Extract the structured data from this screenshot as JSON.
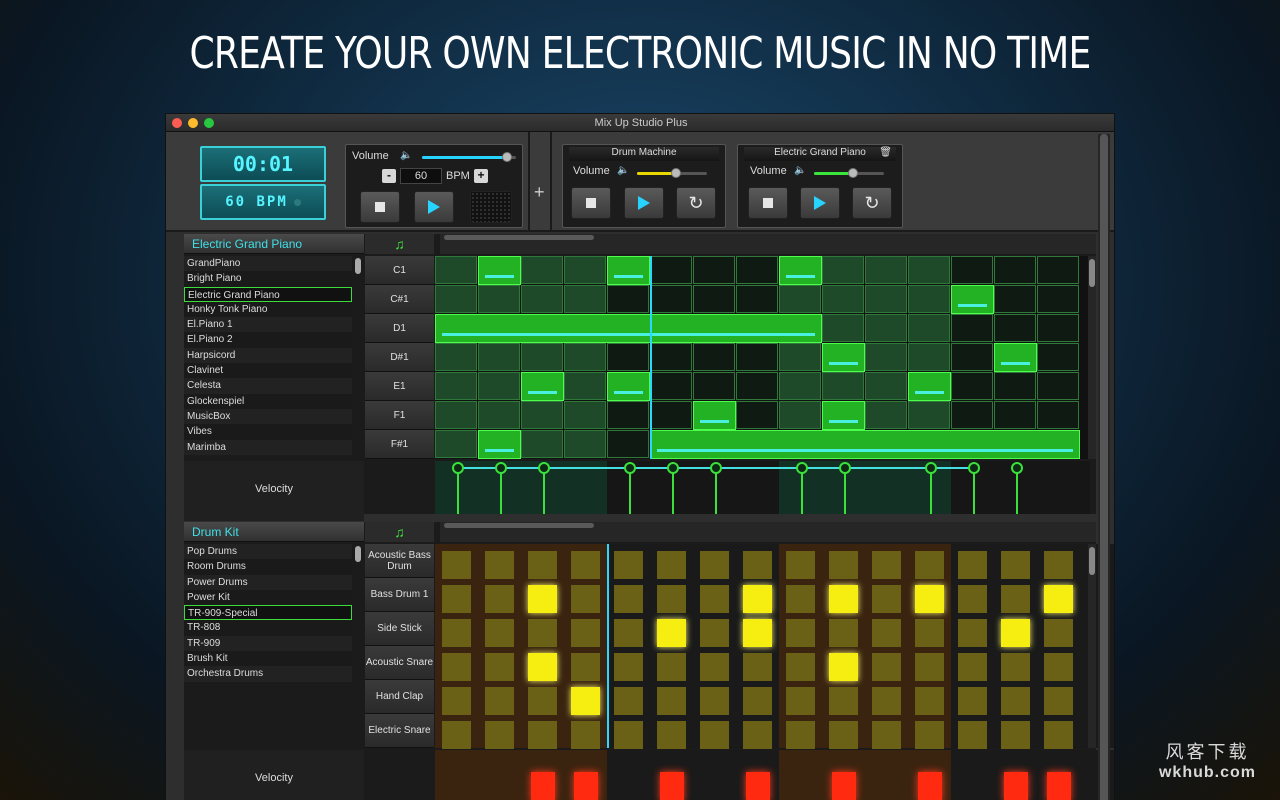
{
  "headline": "CREATE YOUR OWN ELECTRONIC MUSIC IN NO TIME",
  "window": {
    "title": "Mix Up Studio Plus"
  },
  "transport": {
    "time": "00:01",
    "bpm_display": "60 BPM",
    "volume_label": "Volume",
    "bpm_value": "60",
    "bpm_unit": "BPM",
    "minus": "-",
    "plus": "+",
    "volume_level": 0.9
  },
  "add_track_label": "+",
  "track_panels": [
    {
      "name": "Drum Machine",
      "volume_label": "Volume",
      "volume_level": 0.55,
      "accent": "#e8d800"
    },
    {
      "name": "Electric Grand Piano",
      "volume_label": "Volume",
      "volume_level": 0.55,
      "accent": "#39e639"
    }
  ],
  "piano": {
    "instrument": "Electric Grand Piano",
    "note_icon": "♫",
    "instruments": [
      "GrandPiano",
      "Bright Piano",
      "Electric Grand Piano",
      "Honky Tonk Piano",
      "El.Piano 1",
      "El.Piano 2",
      "Harpsicord",
      "Clavinet",
      "Celesta",
      "Glockenspiel",
      "MusicBox",
      "Vibes",
      "Marimba"
    ],
    "selected_index": 2,
    "rows": [
      "C1",
      "C#1",
      "D1",
      "D#1",
      "E1",
      "F1",
      "F#1"
    ],
    "notes": [
      {
        "row": 0,
        "start": 1,
        "len": 1
      },
      {
        "row": 0,
        "start": 4,
        "len": 1
      },
      {
        "row": 0,
        "start": 8,
        "len": 1
      },
      {
        "row": 1,
        "start": 12,
        "len": 1
      },
      {
        "row": 2,
        "start": 0,
        "len": 9
      },
      {
        "row": 3,
        "start": 9,
        "len": 1
      },
      {
        "row": 3,
        "start": 13,
        "len": 1
      },
      {
        "row": 4,
        "start": 2,
        "len": 1
      },
      {
        "row": 4,
        "start": 4,
        "len": 1
      },
      {
        "row": 4,
        "start": 11,
        "len": 1
      },
      {
        "row": 5,
        "start": 6,
        "len": 1
      },
      {
        "row": 5,
        "start": 9,
        "len": 1
      },
      {
        "row": 6,
        "start": 1,
        "len": 1
      },
      {
        "row": 6,
        "start": 5,
        "len": 10
      }
    ],
    "steps": 15,
    "playhead_step": 5,
    "velocity_label": "Velocity",
    "velocity_steps": [
      0,
      1,
      2,
      4,
      5,
      6,
      8,
      9,
      11,
      12,
      13
    ]
  },
  "drums": {
    "instrument": "Drum Kit",
    "note_icon": "♫",
    "instruments": [
      "Pop Drums",
      "Room Drums",
      "Power Drums",
      "Power Kit",
      "TR-909-Special",
      "TR-808",
      "TR-909",
      "Brush Kit",
      "Orchestra Drums"
    ],
    "selected_index": 4,
    "rows": [
      "Acoustic Bass Drum",
      "Bass Drum 1",
      "Side Stick",
      "Acoustic Snare",
      "Hand Clap",
      "Electric Snare"
    ],
    "hits": [
      {
        "row": 1,
        "step": 2
      },
      {
        "row": 1,
        "step": 7
      },
      {
        "row": 1,
        "step": 9
      },
      {
        "row": 1,
        "step": 11
      },
      {
        "row": 1,
        "step": 14
      },
      {
        "row": 2,
        "step": 5
      },
      {
        "row": 2,
        "step": 7
      },
      {
        "row": 2,
        "step": 13
      },
      {
        "row": 3,
        "step": 2
      },
      {
        "row": 3,
        "step": 9
      },
      {
        "row": 4,
        "step": 3
      }
    ],
    "steps": 15,
    "playhead_step": 4,
    "velocity_label": "Velocity",
    "velocity_steps": [
      2,
      3,
      5,
      7,
      9,
      11,
      13,
      14
    ]
  },
  "watermark": {
    "line1": "风客下载",
    "line2": "wkhub.com"
  }
}
